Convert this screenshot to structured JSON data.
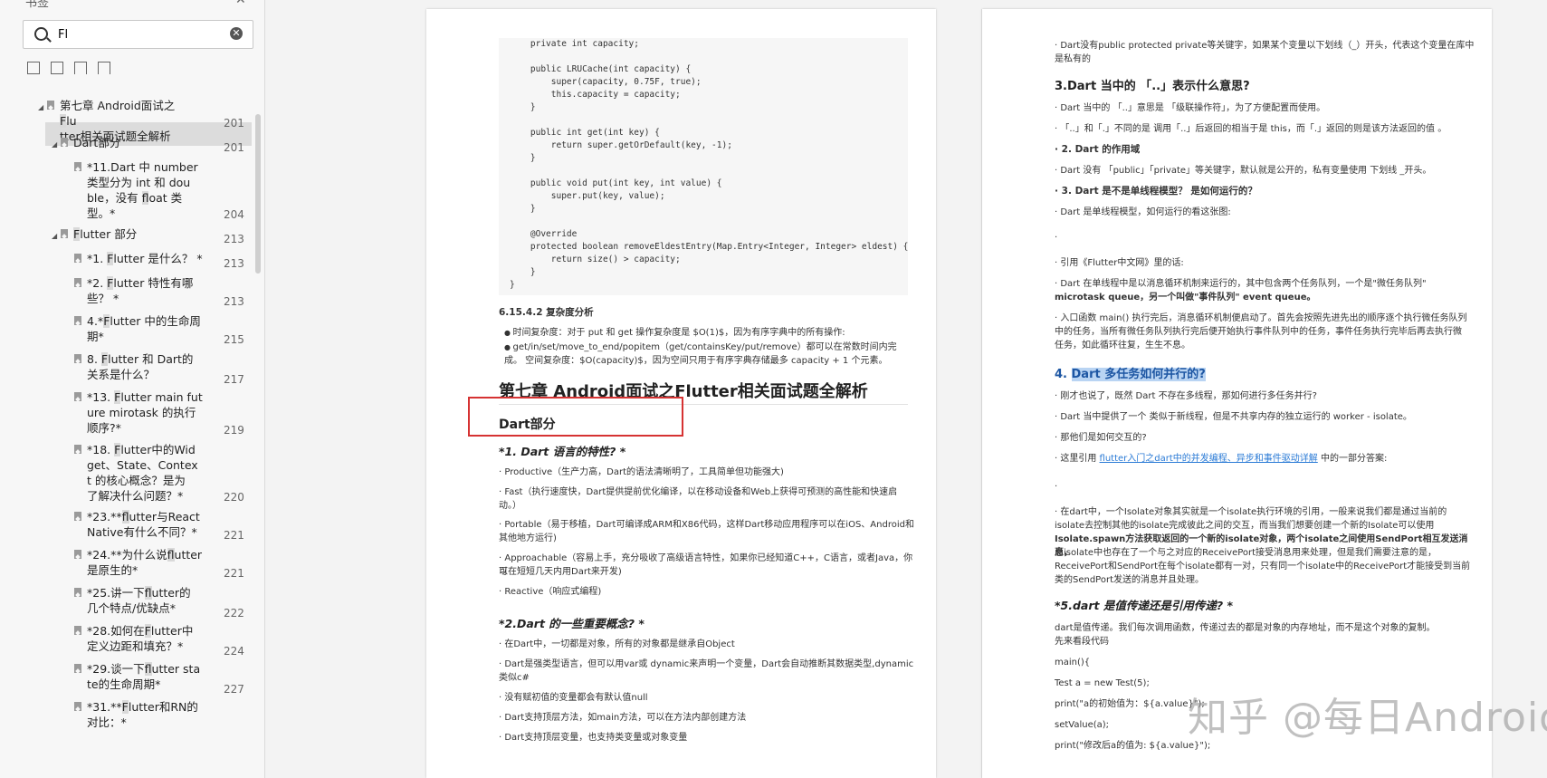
{
  "sidebar": {
    "title": "书签",
    "search": {
      "value": "Fl"
    },
    "toc": [
      {
        "label": "第七章 Android面试之Flutter相关面试题全解析",
        "lines": [
          "第七章 Android面试之Flu",
          "tter相关面试题全解析"
        ],
        "page": "201"
      },
      {
        "label": "Dart部分",
        "lines": [
          "Dart部分"
        ],
        "page": "201"
      },
      {
        "label": "*11.Dart 中 number类型分为 int 和 double，没有 float 类型。*",
        "lines": [
          "*11.Dart 中 number",
          "类型分为 int 和 dou",
          "ble，没有 float 类",
          "型。*"
        ],
        "page": "204"
      },
      {
        "label": "Flutter 部分",
        "lines": [
          "Flutter 部分"
        ],
        "page": "213"
      },
      {
        "label": "*1. Flutter 是什么？ *",
        "lines": [
          "*1. Flutter 是什么？ *"
        ],
        "page": "213"
      },
      {
        "label": "*2. Flutter 特性有哪些？ *",
        "lines": [
          "*2. Flutter 特性有哪",
          "些？ *"
        ],
        "page": "213"
      },
      {
        "label": "4.*Flutter 中的生命周期*",
        "lines": [
          "4.*Flutter 中的生命周",
          "期*"
        ],
        "page": "215"
      },
      {
        "label": "8. Flutter 和 Dart的关系是什么？",
        "lines": [
          "8. Flutter 和 Dart的",
          "关系是什么？"
        ],
        "page": "217"
      },
      {
        "label": "*13. Flutter main future mirotask 的执行顺序?*",
        "lines": [
          "*13. Flutter main fut",
          "ure mirotask 的执行",
          "顺序?*"
        ],
        "page": "219"
      },
      {
        "label": "*18. Flutter中的Widget、State、Context 的核心概念？是为了解决什么问题？*",
        "lines": [
          "*18. Flutter中的Wid",
          "get、State、Contex",
          "t 的核心概念？是为",
          "了解决什么问题？*"
        ],
        "page": "220"
      },
      {
        "label": "*23.**flutter与React Native有什么不同？*",
        "lines": [
          "*23.**flutter与React",
          "Native有什么不同？*"
        ],
        "page": "221"
      },
      {
        "label": "*24.**为什么说flutter是原生的*",
        "lines": [
          "*24.**为什么说flutter",
          "是原生的*"
        ],
        "page": "221"
      },
      {
        "label": "*25.讲一下flutter的几个特点/优缺点*",
        "lines": [
          "*25.讲一下flutter的",
          "几个特点/优缺点*"
        ],
        "page": "222"
      },
      {
        "label": "*28.如何在Flutter中定义边距和填充？*",
        "lines": [
          "*28.如何在Flutter中",
          "定义边距和填充？*"
        ],
        "page": "224"
      },
      {
        "label": "*29.谈一下flutter state的生命周期*",
        "lines": [
          "*29.谈一下flutter sta",
          "te的生命周期*"
        ],
        "page": "227"
      },
      {
        "label": "*31.**Flutter和RN的对比：*",
        "lines": [
          "*31.**Flutter和RN的",
          "对比：*"
        ],
        "page": ""
      }
    ]
  },
  "left_page": {
    "code": "    private int capacity;\n\n    public LRUCache(int capacity) {\n        super(capacity, 0.75F, true);\n        this.capacity = capacity;\n    }\n\n    public int get(int key) {\n        return super.getOrDefault(key, -1);\n    }\n\n    public void put(int key, int value) {\n        super.put(key, value);\n    }\n\n    @Override\n    protected boolean removeEldestEntry(Map.Entry<Integer, Integer> eldest) {\n        return size() > capacity;\n    }\n}",
    "complexity_heading": "6.15.4.2 复杂度分析",
    "bullets": [
      "时间复杂度：对于 put 和 get 操作复杂度是 $O(1)$，因为有序字典中的所有操作:",
      "get/in/set/move_to_end/popitem（get/containsKey/put/remove）都可以在常数时间内完成。 空间复杂度：$O(capacity)$，因为空间只用于有序字典存储最多 capacity + 1 个元素。"
    ],
    "chapter_title": "第七章 Android面试之Flutter相关面试题全解析",
    "section_title": "Dart部分",
    "q1_title": "*1. Dart 语言的特性? *",
    "q1_items": [
      "· Productive（生产力高，Dart的语法清晰明了，工具简单但功能强大)",
      "· Fast（执行速度快，Dart提供提前优化编译，以在移动设备和Web上获得可预测的高性能和快速启",
      "动。）",
      "· Portable（易于移植，Dart可编译成ARM和X86代码，这样Dart移动应用程序可以在iOS、Android和",
      "其他地方运行)",
      "· Approachable（容易上手，充分吸收了高级语言特性，如果你已经知道C++，C语言，或者Java，你可",
      "以在短短几天内用Dart来开发)",
      "· Reactive（响应式编程)"
    ],
    "q2_title": "*2.Dart 的一些重要概念? *",
    "q2_items": [
      "· 在Dart中，一切都是对象，所有的对象都是继承自Object",
      "· Dart是强类型语言，但可以用var或 dynamic来声明一个变量，Dart会自动推断其数据类型,dynamic",
      "类似c#",
      "· 没有赋初值的变量都会有默认值null",
      "· Dart支持顶层方法，如main方法，可以在方法内部创建方法",
      "· Dart支持顶层变量，也支持类变量或对象变量"
    ]
  },
  "right_page": {
    "intro": [
      "· Dart没有public protected private等关键字，如果某个变量以下划线（_）开头，代表这个变量在库中",
      "是私有的"
    ],
    "q3_title": "3.Dart 当中的 「..」表示什么意思?",
    "q3_items": [
      "· Dart 当中的 「..」意思是 「级联操作符」，为了方便配置而使用。",
      "· 「..」和「.」不同的是 调用「..」后返回的相当于是 this，而「.」返回的则是该方法返回的值 。"
    ],
    "scope_title": "· 2. Dart 的作用域",
    "scope_item": "· Dart 没有 「public」「private」等关键字，默认就是公开的，私有变量使用 下划线 _开头。",
    "single_title": "· 3. Dart 是不是单线程模型？ 是如何运行的？",
    "single_item": "· Dart 是单线程模型，如何运行的看这张图:",
    "dot1": ".",
    "quote": "· 引用《Flutter中文网》里的话:",
    "loop1": [
      "· Dart 在单线程中是以消息循环机制来运行的，其中包含两个任务队列，一个是\"微任务队列\"",
      "microtask queue，另一个叫做\"事件队列\" event queue。"
    ],
    "loop2": [
      "· 入口函数 main() 执行完后，消息循环机制便启动了。首先会按照先进先出的顺序逐个执行微任务队列",
      "中的任务，当所有微任务队列执行完后便开始执行事件队列中的任务，事件任务执行完毕后再去执行微",
      "任务，如此循环往复，生生不息。"
    ],
    "q4_prefix": "4. ",
    "q4_title": "Dart 多任务如何并行的?",
    "q4_items": [
      "· 刚才也说了，既然 Dart 不存在多线程，那如何进行多任务并行?",
      "· Dart 当中提供了一个 类似于新线程，但是不共享内存的独立运行的 worker - isolate。",
      "· 那他们是如何交互的?"
    ],
    "ref_prefix": "· 这里引用 ",
    "ref_link": "flutter入门之dart中的并发编程、异步和事件驱动详解",
    "ref_suffix": " 中的一部分答案:",
    "dot2": ".",
    "isolate": [
      "· 在dart中，一个Isolate对象其实就是一个isolate执行环境的引用，一般来说我们都是通过当前的",
      "isolate去控制其他的isolate完成彼此之间的交互，而当我们想要创建一个新的Isolate可以使用",
      "Isolate.spawn方法获取返回的一个新的isolate对象，两个isolate之间使用SendPort相互发送消息，",
      "而isolate中也存在了一个与之对应的ReceivePort接受消息用来处理，但是我们需要注意的是，",
      "ReceivePort和SendPort在每个isolate都有一对，只有同一个isolate中的ReceivePort才能接受到当前",
      "类的SendPort发送的消息并且处理。"
    ],
    "q5_title": "*5.dart 是值传递还是引用传递? *",
    "q5_items": [
      "dart是值传递。我们每次调用函数，传递过去的都是对象的内存地址，而不是这个对象的复制。",
      "先来看段代码",
      "main(){",
      " Test a = new Test(5);",
      " print(\"a的初始值为：${a.value}\");",
      " setValue(a);",
      " print(\"修改后a的值为: ${a.value}\");"
    ]
  },
  "watermark": "知乎 @每日Android"
}
